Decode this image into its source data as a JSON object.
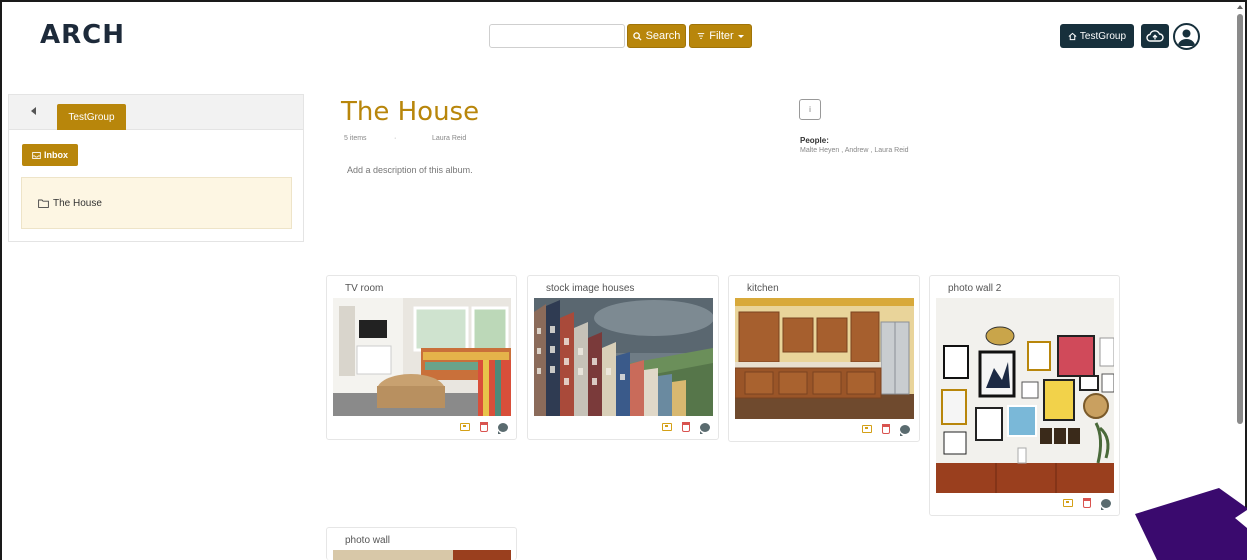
{
  "app": {
    "logo": "ARCH"
  },
  "header": {
    "search_placeholder": "",
    "search_label": "Search",
    "filter_label": "Filter",
    "group_label": "TestGroup"
  },
  "sidebar": {
    "active_tab": "TestGroup",
    "inbox_label": "Inbox",
    "albums": [
      {
        "label": "The House"
      }
    ]
  },
  "album": {
    "title": "The House",
    "items_count": "5 items",
    "separator": "·",
    "owner": "Laura Reid",
    "description": "Add a description of this album.",
    "info_symbol": "i",
    "people_label": "People:",
    "people_names": "Malte Heyen , Andrew , Laura Reid"
  },
  "cards": [
    {
      "title": "TV room"
    },
    {
      "title": "stock image houses"
    },
    {
      "title": "kitchen"
    },
    {
      "title": "photo wall 2"
    },
    {
      "title": "photo wall"
    }
  ],
  "colors": {
    "accent": "#b8860b",
    "dark": "#17303c",
    "album_bg": "#fdf6e3",
    "delete": "#d9534f",
    "decor": "#3a0a6e"
  }
}
